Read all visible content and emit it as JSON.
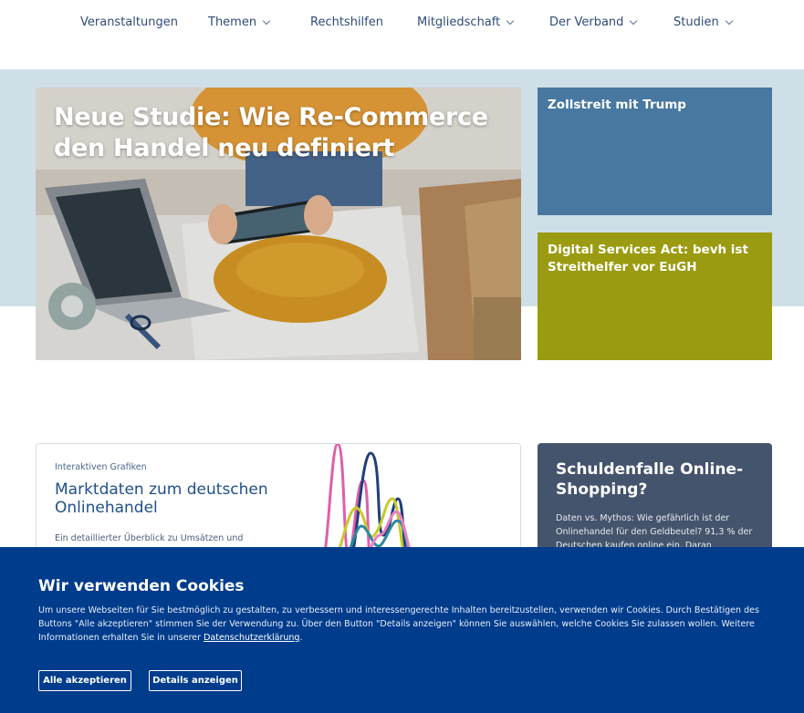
{
  "nav": {
    "items": [
      {
        "label": "Veranstaltungen",
        "has_dropdown": false
      },
      {
        "label": "Themen",
        "has_dropdown": true
      },
      {
        "label": "Rechtshilfen",
        "has_dropdown": false
      },
      {
        "label": "Mitgliedschaft",
        "has_dropdown": true
      },
      {
        "label": "Der Verband",
        "has_dropdown": true
      },
      {
        "label": "Studien",
        "has_dropdown": true
      }
    ]
  },
  "hero": {
    "feature_title": "Neue Studie: Wie Re-Commerce den Handel neu definiert",
    "tiles": [
      {
        "title": "Zollstreit mit Trump",
        "color": "#4878a0"
      },
      {
        "title": "Digital Services Act: bevh ist Streithelfer vor EuGH",
        "color": "#9a9b10"
      }
    ]
  },
  "market_card": {
    "kicker": "Interaktiven Grafiken",
    "title": "Marktdaten zum deutschen Onlinehandel",
    "text": "Ein detaillierter Überblick zu Umsätzen und"
  },
  "debt_card": {
    "title": "Schuldenfalle Online-Shopping?",
    "text": "Daten vs. Mythos: Wie gefährlich ist der Onlinehandel für den Geldbeutel? 91,3 % der Deutschen kaufen online ein. Daran gemessen"
  },
  "cookie": {
    "title": "Wir verwenden Cookies",
    "text": "Um unsere Webseiten für Sie bestmöglich zu gestalten, zu verbessern und interessengerechte Inhalten bereitzustellen, verwenden wir Cookies. Durch Bestätigen des Buttons \"Alle akzeptieren\" stimmen Sie der Verwendung zu. Über den Button \"Details anzeigen\" können Sie auswählen, welche Cookies Sie zulassen wollen. Weitere Informationen erhalten Sie in unserer ",
    "link": "Datenschutzerklärung",
    "text_end": ".",
    "accept_label": "Alle akzeptieren",
    "details_label": "Details anzeigen"
  },
  "colors": {
    "nav_text": "#2e4b78",
    "hero_band": "#cfdfe8",
    "cookie_bg": "#003c8c",
    "debt_card_bg": "#45546d"
  }
}
